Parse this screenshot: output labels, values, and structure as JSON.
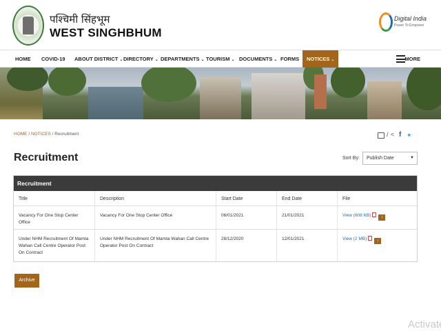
{
  "header": {
    "site_hindi": "पश्चिमी सिंहभूम",
    "site_title": "WEST SINGHBHUM",
    "digital_india": {
      "name": "Digital India",
      "tagline": "Power To Empower"
    }
  },
  "nav": {
    "items": [
      {
        "label": "HOME",
        "dropdown": false
      },
      {
        "label": "COVID-19",
        "dropdown": false
      },
      {
        "label": "ABOUT DISTRICT",
        "dropdown": true
      },
      {
        "label": "DIRECTORY",
        "dropdown": true
      },
      {
        "label": "DEPARTMENTS",
        "dropdown": true
      },
      {
        "label": "TOURISM",
        "dropdown": true
      },
      {
        "label": "DOCUMENTS",
        "dropdown": true
      },
      {
        "label": "FORMS",
        "dropdown": false
      },
      {
        "label": "NOTICES",
        "dropdown": true,
        "active": true
      }
    ],
    "more": "MORE"
  },
  "breadcrumb": {
    "home": "HOME",
    "sep": "/",
    "notices": "NOTICES",
    "current": "Recruitment"
  },
  "page_title": "Recruitment",
  "sort": {
    "label": "Sort By:",
    "selected": "Publish Date"
  },
  "table": {
    "heading": "Recruitment",
    "columns": [
      "Title",
      "Description",
      "Start Date",
      "End Date",
      "File"
    ],
    "rows": [
      {
        "title": "Vacancy For One Stop Center Office",
        "description": "Vacancy For One Stop Center Office",
        "start": "06/01/2021",
        "end": "21/01/2021",
        "file": "View (608 KB)"
      },
      {
        "title": "Under NHM Recruitment Of Mamta Wahan Call Centre Operator Post On Contract",
        "description": "Under NHM Recruitment Of Mamta Wahan Call Centre Operator Post On Contract",
        "start": "28/12/2020",
        "end": "12/01/2021",
        "file": "View (2 MB)"
      }
    ]
  },
  "archive_label": "Archive",
  "watermark": "Activate",
  "colors": {
    "accent": "#a2651a",
    "table_header": "#3b3b3b",
    "link": "#1d6db3"
  }
}
